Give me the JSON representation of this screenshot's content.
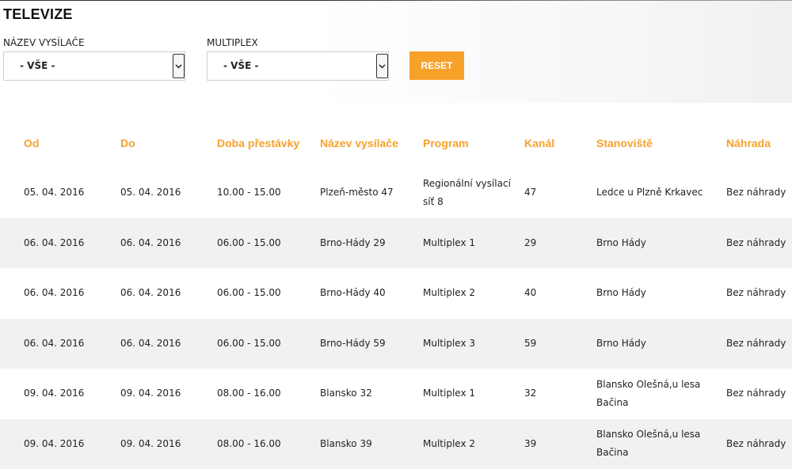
{
  "title": "TELEVIZE",
  "filters": {
    "station_label": "NÁZEV VYSÍLAČE",
    "station_value": "- VŠE -",
    "multiplex_label": "MULTIPLEX",
    "multiplex_value": "- VŠE -",
    "reset_label": "RESET"
  },
  "colors": {
    "accent": "#f7a12b",
    "stripe": "#f1f1f1"
  },
  "table": {
    "headers": [
      "Od",
      "Do",
      "Doba přestávky",
      "Název vysílače",
      "Program",
      "Kanál",
      "Stanoviště",
      "Náhrada"
    ],
    "rows": [
      [
        "05. 04. 2016",
        "05. 04. 2016",
        "10.00 - 15.00",
        "Plzeň-město 47",
        "Regionální vysílací síť 8",
        "47",
        "Ledce u Plzně Krkavec",
        "Bez náhrady"
      ],
      [
        "06. 04. 2016",
        "06. 04. 2016",
        "06.00 - 15.00",
        "Brno-Hády 29",
        "Multiplex 1",
        "29",
        "Brno Hády",
        "Bez náhrady"
      ],
      [
        "06. 04. 2016",
        "06. 04. 2016",
        "06.00 - 15.00",
        "Brno-Hády 40",
        "Multiplex 2",
        "40",
        "Brno Hády",
        "Bez náhrady"
      ],
      [
        "06. 04. 2016",
        "06. 04. 2016",
        "06.00 - 15.00",
        "Brno-Hády 59",
        "Multiplex 3",
        "59",
        "Brno Hády",
        "Bez náhrady"
      ],
      [
        "09. 04. 2016",
        "09. 04. 2016",
        "08.00 - 16.00",
        "Blansko 32",
        "Multiplex 1",
        "32",
        "Blansko Olešná,u lesa Bačina",
        "Bez náhrady"
      ],
      [
        "09. 04. 2016",
        "09. 04. 2016",
        "08.00 - 16.00",
        "Blansko 39",
        "Multiplex 2",
        "39",
        "Blansko Olešná,u lesa Bačina",
        "Bez náhrady"
      ]
    ]
  }
}
